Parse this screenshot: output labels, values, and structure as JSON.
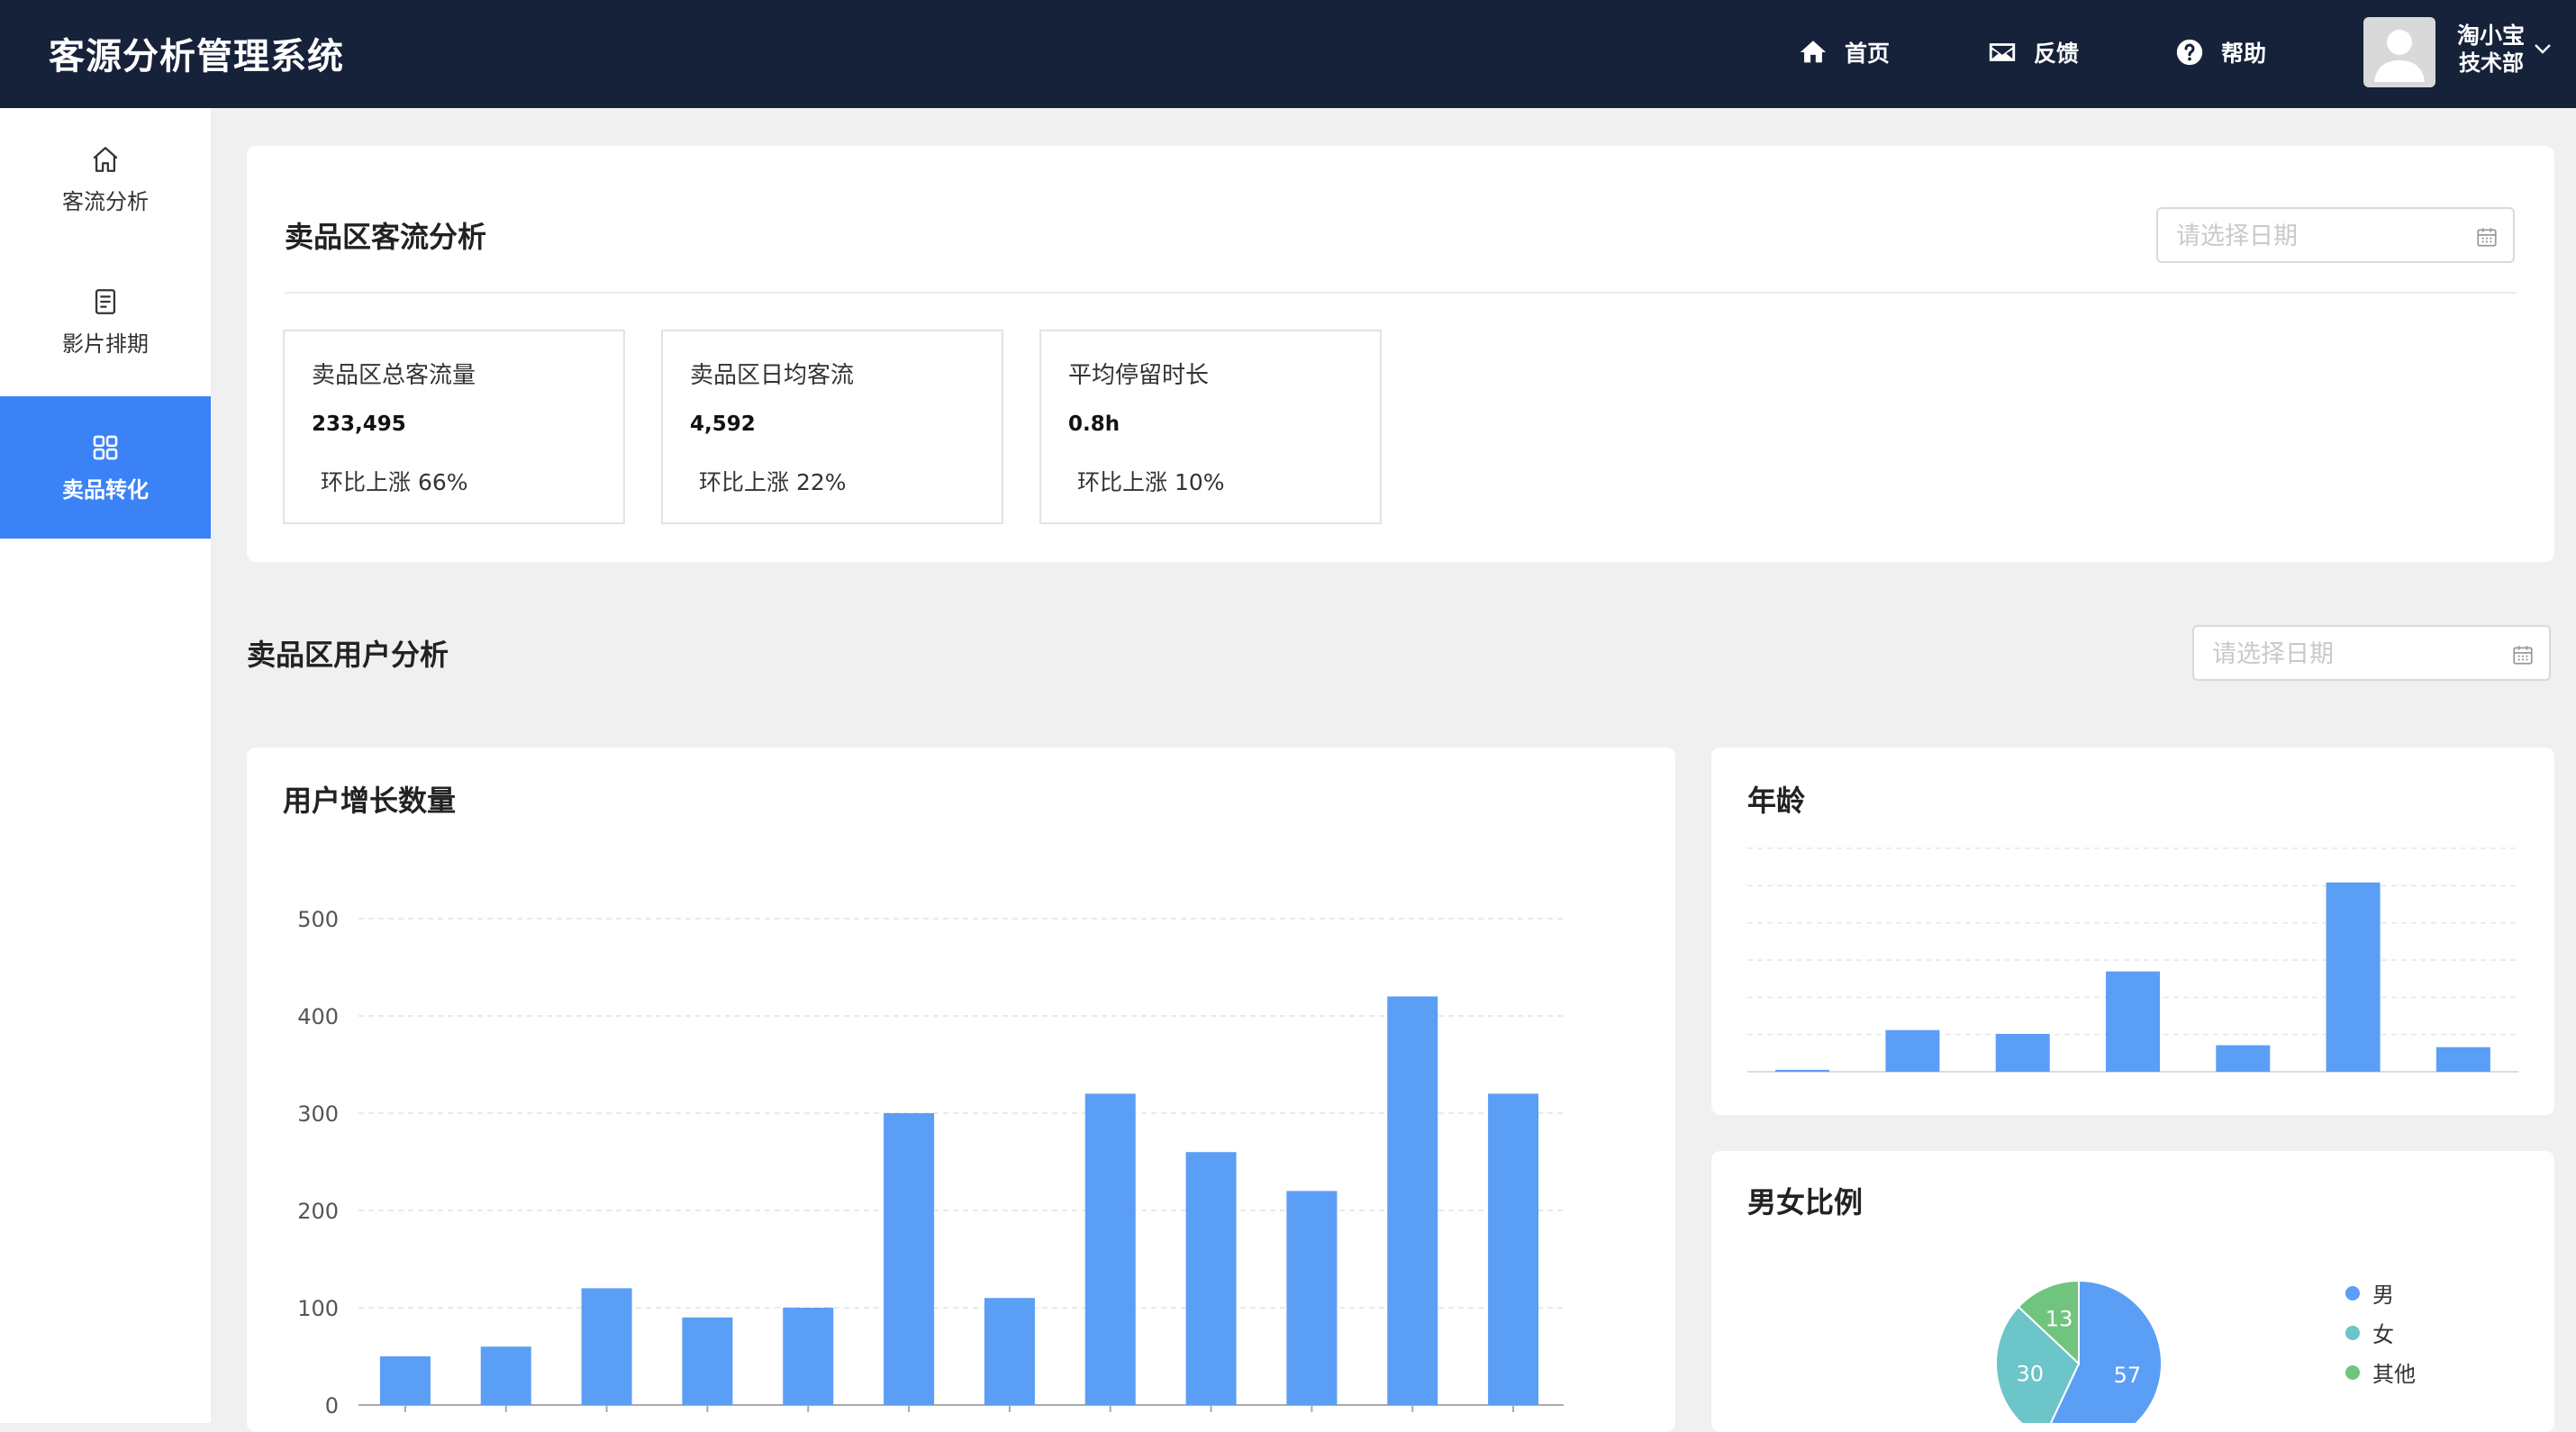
{
  "header": {
    "app_title": "客源分析管理系统",
    "nav": [
      {
        "label": "首页",
        "icon": "home-icon"
      },
      {
        "label": "反馈",
        "icon": "mail-icon"
      },
      {
        "label": "帮助",
        "icon": "help-icon"
      }
    ],
    "user": {
      "name": "淘小宝",
      "dept": "技术部"
    }
  },
  "sidebar": {
    "items": [
      {
        "label": "客流分析",
        "icon": "home-outline-icon",
        "active": false
      },
      {
        "label": "影片排期",
        "icon": "document-icon",
        "active": false
      },
      {
        "label": "卖品转化",
        "icon": "grid-icon",
        "active": true
      }
    ]
  },
  "traffic": {
    "title": "卖品区客流分析",
    "date_placeholder": "请选择日期",
    "stats": [
      {
        "label": "卖品区总客流量",
        "value": "233,495",
        "change": "环比上涨 66%"
      },
      {
        "label": "卖品区日均客流",
        "value": "4,592",
        "change": "环比上涨 22%"
      },
      {
        "label": "平均停留时长",
        "value": "0.8h",
        "change": "环比上涨 10%"
      }
    ]
  },
  "users": {
    "title": "卖品区用户分析",
    "date_placeholder": "请选择日期"
  },
  "colors": {
    "header_bg": "#16213a",
    "accent": "#3b82f6",
    "bar": "#5b9ef6",
    "pie_male": "#5b9ef6",
    "pie_female": "#6cc5c8",
    "pie_other": "#71c47e"
  },
  "chart_data": [
    {
      "type": "bar",
      "title": "用户增长数量",
      "categories": [
        "",
        "",
        "",
        "",
        "",
        "",
        "",
        "",
        "",
        "",
        "",
        ""
      ],
      "values": [
        50,
        60,
        120,
        90,
        100,
        300,
        110,
        320,
        260,
        220,
        420,
        320
      ],
      "ylim": [
        0,
        500
      ],
      "yticks": [
        "0",
        "100",
        "200",
        "300",
        "400",
        "500"
      ],
      "grid": true
    },
    {
      "type": "bar",
      "title": "年龄",
      "categories": [
        "",
        "",
        "",
        "",
        "",
        "",
        ""
      ],
      "values": [
        1,
        22,
        20,
        53,
        14,
        100,
        13
      ],
      "ylim": [
        0,
        118
      ],
      "grid": true
    },
    {
      "type": "pie",
      "title": "男女比例",
      "labels": [
        "男",
        "女",
        "其他"
      ],
      "values": [
        57,
        30,
        13
      ],
      "legend": "right"
    }
  ]
}
